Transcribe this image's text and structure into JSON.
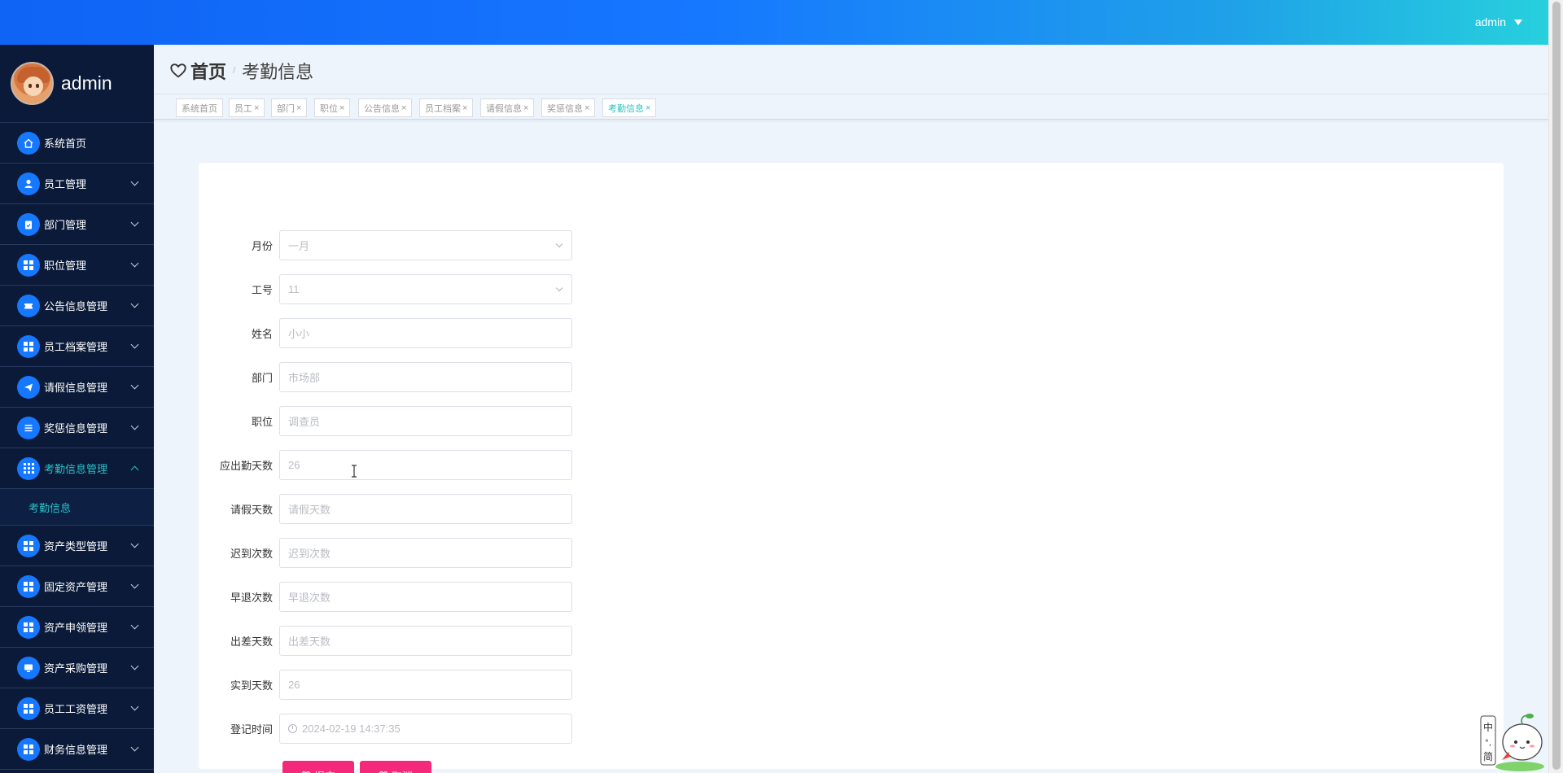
{
  "header": {
    "username": "admin"
  },
  "sidebar": {
    "username": "admin",
    "items": [
      {
        "label": "系统首页",
        "icon": "home-icon"
      },
      {
        "label": "员工管理",
        "icon": "user-icon"
      },
      {
        "label": "部门管理",
        "icon": "clipboard-icon"
      },
      {
        "label": "职位管理",
        "icon": "grid-icon"
      },
      {
        "label": "公告信息管理",
        "icon": "ticket-icon"
      },
      {
        "label": "员工档案管理",
        "icon": "grid-icon"
      },
      {
        "label": "请假信息管理",
        "icon": "send-icon"
      },
      {
        "label": "奖惩信息管理",
        "icon": "list-icon"
      },
      {
        "label": "考勤信息管理",
        "icon": "apps-icon"
      },
      {
        "label": "资产类型管理",
        "icon": "grid-icon"
      },
      {
        "label": "固定资产管理",
        "icon": "grid-icon"
      },
      {
        "label": "资产申领管理",
        "icon": "grid-icon"
      },
      {
        "label": "资产采购管理",
        "icon": "monitor-icon"
      },
      {
        "label": "员工工资管理",
        "icon": "grid-icon"
      },
      {
        "label": "财务信息管理",
        "icon": "grid-icon"
      }
    ],
    "subitem": "考勤信息"
  },
  "breadcrumb": {
    "home": "首页",
    "separator": "/",
    "current": "考勤信息"
  },
  "tags": [
    {
      "label": "系统首页"
    },
    {
      "label": "员工"
    },
    {
      "label": "部门"
    },
    {
      "label": "职位"
    },
    {
      "label": "公告信息"
    },
    {
      "label": "员工档案"
    },
    {
      "label": "请假信息"
    },
    {
      "label": "奖惩信息"
    },
    {
      "label": "考勤信息"
    }
  ],
  "tag_close": "×",
  "form": {
    "month": {
      "label": "月份",
      "value": "一月"
    },
    "employee_no": {
      "label": "工号",
      "value": "11"
    },
    "name": {
      "label": "姓名",
      "value": "小小"
    },
    "department": {
      "label": "部门",
      "value": "市场部"
    },
    "position": {
      "label": "职位",
      "value": "调查员"
    },
    "required_days": {
      "label": "应出勤天数",
      "value": "26"
    },
    "leave_days": {
      "label": "请假天数",
      "placeholder": "请假天数"
    },
    "late_count": {
      "label": "迟到次数",
      "placeholder": "迟到次数"
    },
    "early_leave_count": {
      "label": "早退次数",
      "placeholder": "早退次数"
    },
    "business_trip_days": {
      "label": "出差天数",
      "placeholder": "出差天数"
    },
    "actual_days": {
      "label": "实到天数",
      "value": "26"
    },
    "register_time": {
      "label": "登记时间",
      "value": "2024-02-19 14:37:35"
    },
    "submit_label": "提交",
    "cancel_label": "取消"
  },
  "colors": {
    "topbar_start": "#0f63f5",
    "topbar_end": "#27d0dd",
    "sidebar_bg": "#0a1a38",
    "accent": "#2bc0c8",
    "button": "#f5297c",
    "icon_bg": "#1677ff"
  }
}
